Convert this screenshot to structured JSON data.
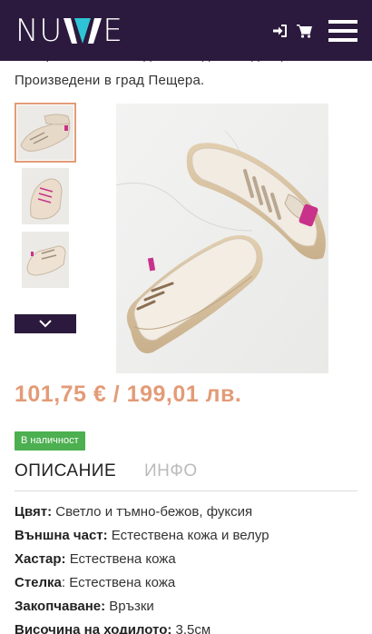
{
  "header": {
    "logo_left": "NU",
    "logo_right": "E",
    "logo_w_colors": [
      "#ffffff",
      "#2ec4d6"
    ]
  },
  "intro": {
    "line1": "съобразени с последните модни тенденции.",
    "line2": "Произведени в град Пещера."
  },
  "gallery": {
    "thumbnails": [
      "thumb-1",
      "thumb-2",
      "thumb-3"
    ],
    "active_index": 0
  },
  "price": {
    "eur": "101,75 €",
    "separator": " / ",
    "bgn": "199,01 лв."
  },
  "stock_badge": "В наличност",
  "tabs": [
    {
      "label": "ОПИСАНИЕ",
      "active": true
    },
    {
      "label": "ИНФО",
      "active": false
    }
  ],
  "specs": [
    {
      "key": "Цвят:",
      "value": " Светло и тъмно-бежов, фуксия"
    },
    {
      "key": "Външна част:",
      "value": " Естествена кожа и велур"
    },
    {
      "key": "Хастар:",
      "value": " Естествена кожа"
    },
    {
      "key": "Стелка",
      "value": ": Естествена кожа"
    },
    {
      "key": "Закопчаване:",
      "value": " Връзки"
    },
    {
      "key": "Височина на ходилото:",
      "value": " 3,5см"
    }
  ],
  "colors": {
    "header_bg": "#2b1a3d",
    "accent": "#e39b77",
    "stock_green": "#4caf50"
  }
}
